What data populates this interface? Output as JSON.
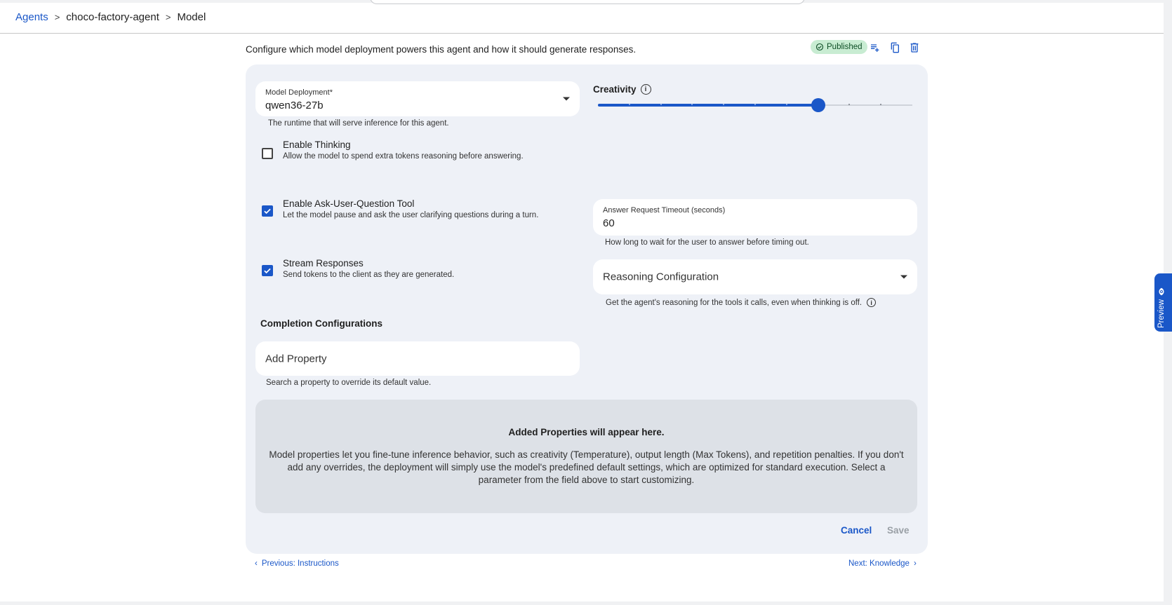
{
  "breadcrumb": {
    "root": "Agents",
    "separator": ">",
    "agent": "choco-factory-agent",
    "current": "Model"
  },
  "header": {
    "description": "Configure which model deployment powers this agent and how it should generate responses.",
    "status": "Published",
    "icons": [
      "playlist-add-icon",
      "copy-icon",
      "delete-icon"
    ]
  },
  "model_deployment": {
    "label": "Model Deployment*",
    "value": "qwen36-27b",
    "help": "The runtime that will serve inference for this agent."
  },
  "creativity": {
    "label": "Creativity",
    "steps": 10,
    "value_step": 7
  },
  "enable_thinking": {
    "title": "Enable Thinking",
    "description": "Allow the model to spend extra tokens reasoning before answering.",
    "checked": false
  },
  "enable_ask_user": {
    "title": "Enable Ask-User-Question Tool",
    "description": "Let the model pause and ask the user clarifying questions during a turn.",
    "checked": true
  },
  "answer_timeout": {
    "label": "Answer Request Timeout (seconds)",
    "value": "60",
    "help": "How long to wait for the user to answer before timing out."
  },
  "stream_responses": {
    "title": "Stream Responses",
    "description": "Send tokens to the client as they are generated.",
    "checked": true
  },
  "reasoning_config": {
    "placeholder": "Reasoning Configuration",
    "help": "Get the agent's reasoning for the tools it calls, even when thinking is off."
  },
  "completion": {
    "section_title": "Completion Configurations",
    "add_property_placeholder": "Add Property",
    "help": "Search a property to override its default value."
  },
  "empty_state": {
    "title": "Added Properties will appear here.",
    "text": "Model properties let you fine-tune inference behavior, such as creativity (Temperature), output length (Max Tokens), and repetition penalties. If you don't add any overrides, the deployment will simply use the model's predefined default settings, which are optimized for standard execution. Select a parameter from the field above to start customizing."
  },
  "actions": {
    "cancel": "Cancel",
    "save": "Save"
  },
  "navigation": {
    "previous": "Previous: Instructions",
    "next": "Next: Knowledge"
  },
  "preview_tab": {
    "label": "Preview"
  },
  "colors": {
    "accent": "#1a57c8",
    "card_bg": "#eef1f7",
    "empty_bg": "#dde1e7",
    "badge_bg": "#c8ecd2",
    "badge_text": "#0d4d25",
    "disabled_text": "#9aa0a6"
  }
}
